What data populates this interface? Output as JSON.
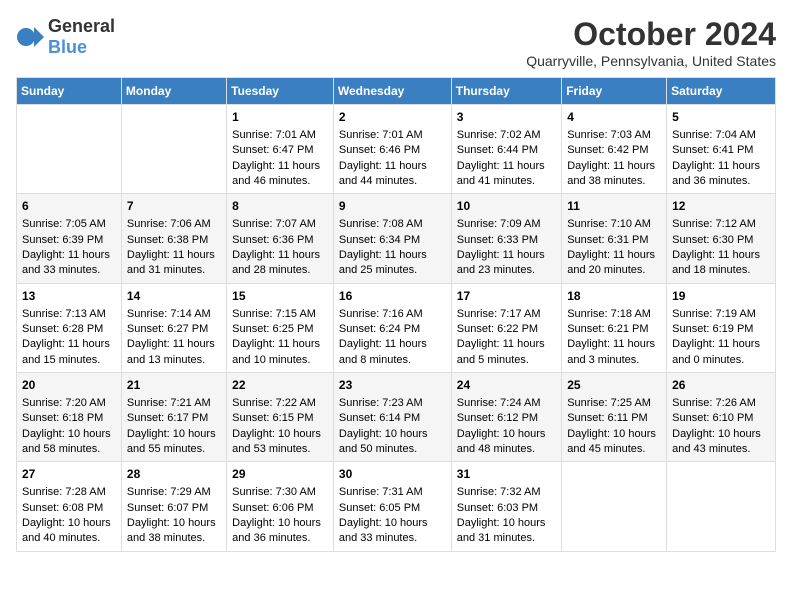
{
  "logo": {
    "text_general": "General",
    "text_blue": "Blue"
  },
  "title": "October 2024",
  "subtitle": "Quarryville, Pennsylvania, United States",
  "days_of_week": [
    "Sunday",
    "Monday",
    "Tuesday",
    "Wednesday",
    "Thursday",
    "Friday",
    "Saturday"
  ],
  "weeks": [
    [
      {
        "day": "",
        "content": ""
      },
      {
        "day": "",
        "content": ""
      },
      {
        "day": "1",
        "content": "Sunrise: 7:01 AM\nSunset: 6:47 PM\nDaylight: 11 hours and 46 minutes."
      },
      {
        "day": "2",
        "content": "Sunrise: 7:01 AM\nSunset: 6:46 PM\nDaylight: 11 hours and 44 minutes."
      },
      {
        "day": "3",
        "content": "Sunrise: 7:02 AM\nSunset: 6:44 PM\nDaylight: 11 hours and 41 minutes."
      },
      {
        "day": "4",
        "content": "Sunrise: 7:03 AM\nSunset: 6:42 PM\nDaylight: 11 hours and 38 minutes."
      },
      {
        "day": "5",
        "content": "Sunrise: 7:04 AM\nSunset: 6:41 PM\nDaylight: 11 hours and 36 minutes."
      }
    ],
    [
      {
        "day": "6",
        "content": "Sunrise: 7:05 AM\nSunset: 6:39 PM\nDaylight: 11 hours and 33 minutes."
      },
      {
        "day": "7",
        "content": "Sunrise: 7:06 AM\nSunset: 6:38 PM\nDaylight: 11 hours and 31 minutes."
      },
      {
        "day": "8",
        "content": "Sunrise: 7:07 AM\nSunset: 6:36 PM\nDaylight: 11 hours and 28 minutes."
      },
      {
        "day": "9",
        "content": "Sunrise: 7:08 AM\nSunset: 6:34 PM\nDaylight: 11 hours and 25 minutes."
      },
      {
        "day": "10",
        "content": "Sunrise: 7:09 AM\nSunset: 6:33 PM\nDaylight: 11 hours and 23 minutes."
      },
      {
        "day": "11",
        "content": "Sunrise: 7:10 AM\nSunset: 6:31 PM\nDaylight: 11 hours and 20 minutes."
      },
      {
        "day": "12",
        "content": "Sunrise: 7:12 AM\nSunset: 6:30 PM\nDaylight: 11 hours and 18 minutes."
      }
    ],
    [
      {
        "day": "13",
        "content": "Sunrise: 7:13 AM\nSunset: 6:28 PM\nDaylight: 11 hours and 15 minutes."
      },
      {
        "day": "14",
        "content": "Sunrise: 7:14 AM\nSunset: 6:27 PM\nDaylight: 11 hours and 13 minutes."
      },
      {
        "day": "15",
        "content": "Sunrise: 7:15 AM\nSunset: 6:25 PM\nDaylight: 11 hours and 10 minutes."
      },
      {
        "day": "16",
        "content": "Sunrise: 7:16 AM\nSunset: 6:24 PM\nDaylight: 11 hours and 8 minutes."
      },
      {
        "day": "17",
        "content": "Sunrise: 7:17 AM\nSunset: 6:22 PM\nDaylight: 11 hours and 5 minutes."
      },
      {
        "day": "18",
        "content": "Sunrise: 7:18 AM\nSunset: 6:21 PM\nDaylight: 11 hours and 3 minutes."
      },
      {
        "day": "19",
        "content": "Sunrise: 7:19 AM\nSunset: 6:19 PM\nDaylight: 11 hours and 0 minutes."
      }
    ],
    [
      {
        "day": "20",
        "content": "Sunrise: 7:20 AM\nSunset: 6:18 PM\nDaylight: 10 hours and 58 minutes."
      },
      {
        "day": "21",
        "content": "Sunrise: 7:21 AM\nSunset: 6:17 PM\nDaylight: 10 hours and 55 minutes."
      },
      {
        "day": "22",
        "content": "Sunrise: 7:22 AM\nSunset: 6:15 PM\nDaylight: 10 hours and 53 minutes."
      },
      {
        "day": "23",
        "content": "Sunrise: 7:23 AM\nSunset: 6:14 PM\nDaylight: 10 hours and 50 minutes."
      },
      {
        "day": "24",
        "content": "Sunrise: 7:24 AM\nSunset: 6:12 PM\nDaylight: 10 hours and 48 minutes."
      },
      {
        "day": "25",
        "content": "Sunrise: 7:25 AM\nSunset: 6:11 PM\nDaylight: 10 hours and 45 minutes."
      },
      {
        "day": "26",
        "content": "Sunrise: 7:26 AM\nSunset: 6:10 PM\nDaylight: 10 hours and 43 minutes."
      }
    ],
    [
      {
        "day": "27",
        "content": "Sunrise: 7:28 AM\nSunset: 6:08 PM\nDaylight: 10 hours and 40 minutes."
      },
      {
        "day": "28",
        "content": "Sunrise: 7:29 AM\nSunset: 6:07 PM\nDaylight: 10 hours and 38 minutes."
      },
      {
        "day": "29",
        "content": "Sunrise: 7:30 AM\nSunset: 6:06 PM\nDaylight: 10 hours and 36 minutes."
      },
      {
        "day": "30",
        "content": "Sunrise: 7:31 AM\nSunset: 6:05 PM\nDaylight: 10 hours and 33 minutes."
      },
      {
        "day": "31",
        "content": "Sunrise: 7:32 AM\nSunset: 6:03 PM\nDaylight: 10 hours and 31 minutes."
      },
      {
        "day": "",
        "content": ""
      },
      {
        "day": "",
        "content": ""
      }
    ]
  ]
}
